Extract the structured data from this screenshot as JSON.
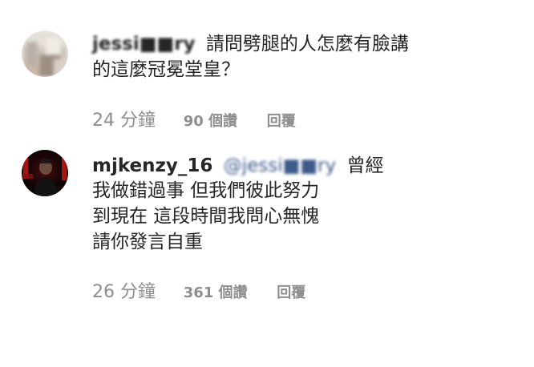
{
  "comments": [
    {
      "username": "jessi■■ry",
      "text_first": "請問劈腿的人怎麼有臉講",
      "text_lines": [
        "的這麼冠冕堂皇？"
      ],
      "time": "24 分鐘",
      "likes": "90 個讚",
      "reply": "回覆"
    },
    {
      "username": "mjkenzy_16",
      "mention": "@jessi■■ry",
      "text_first": "曾經",
      "text_lines": [
        "我做錯過事 但我們彼此努力",
        "到現在 這段時間我問心無愧",
        "請你發言自重"
      ],
      "time": "26 分鐘",
      "likes": "361 個讚",
      "reply": "回覆"
    }
  ],
  "colors": {
    "text": "#262626",
    "meta": "#8e8e8e",
    "mention": "#3d5a8a"
  }
}
